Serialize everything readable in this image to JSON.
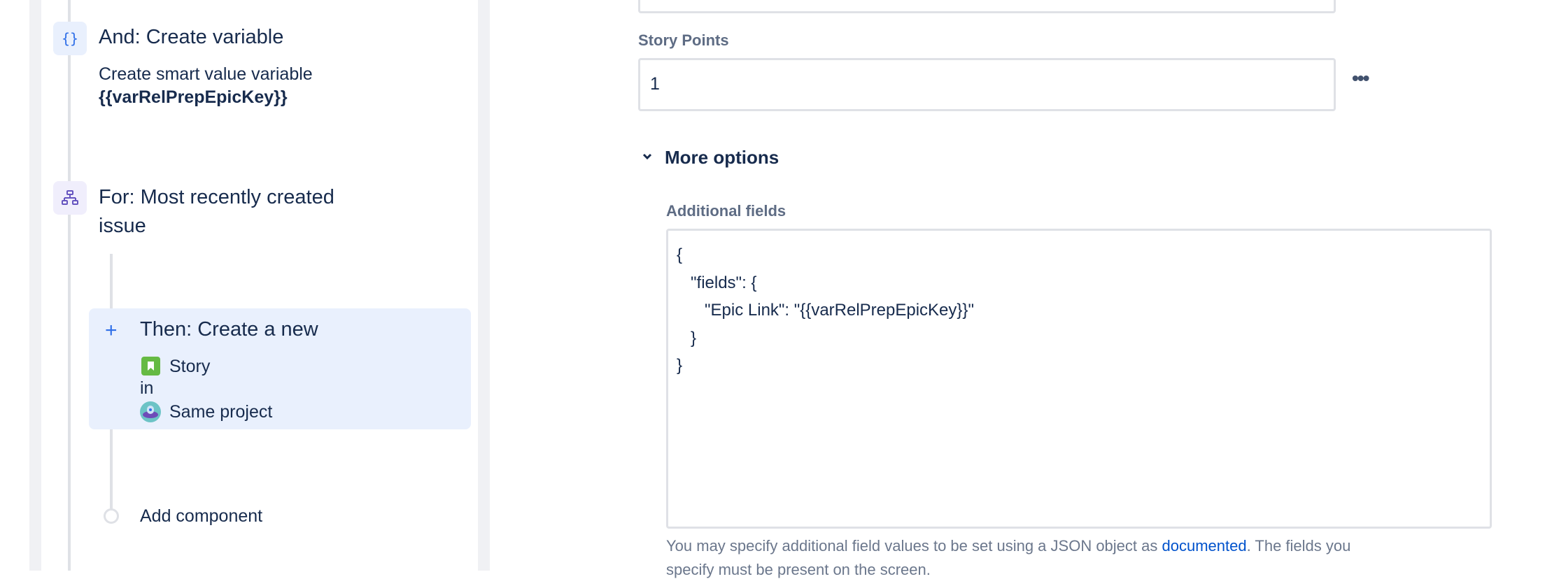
{
  "rule_steps": [
    {
      "title": "And: Create variable",
      "description": "Create smart value variable",
      "variable": "{{varRelPrepEpicKey}}",
      "icon": "braces-icon"
    },
    {
      "title": "For: Most recently created",
      "title_line2": "issue",
      "icon": "hierarchy-icon"
    }
  ],
  "then_step": {
    "title": "Then: Create a new",
    "issue_type": "Story",
    "connector": "in",
    "project": "Same project",
    "add_icon": "plus-icon"
  },
  "add_component": "Add component",
  "form": {
    "story_points_label": "Story Points",
    "story_points_value": "1",
    "more_icon": "ellipsis-icon",
    "more_options_label": "More options",
    "additional_fields_label": "Additional fields",
    "json_lines": [
      "{",
      "   \"fields\": {",
      "      \"Epic Link\": \"{{varRelPrepEpicKey}}\"",
      "   }",
      "}"
    ],
    "help_prefix": "You may specify additional field values to be set using a JSON object as ",
    "help_link": "documented",
    "help_suffix": ". The fields you",
    "help_line2": "specify must be present on the screen."
  },
  "colors": {
    "accent": "#0052cc",
    "highlight": "#e9f0fd",
    "story_green": "#65ba43"
  }
}
